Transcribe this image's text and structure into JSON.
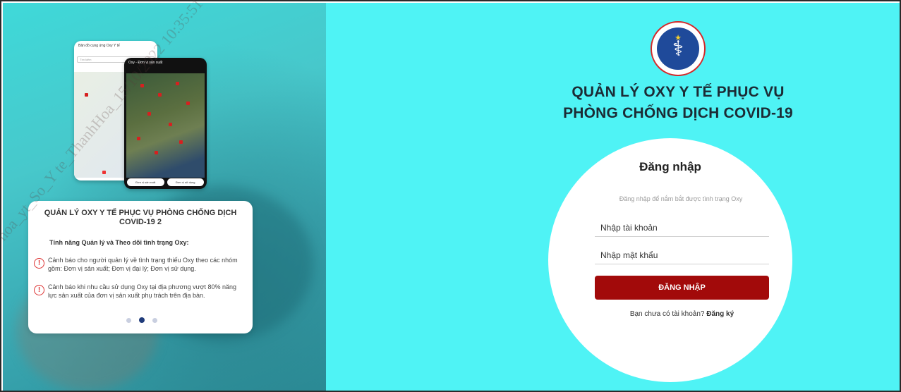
{
  "brand": {
    "logo_text": "BỘ Y TẾ",
    "app_title_line1": "QUẢN LÝ OXY Y TẾ PHỤC VỤ",
    "app_title_line2": "PHÒNG CHỐNG DỊCH COVID-19"
  },
  "login": {
    "heading": "Đăng nhập",
    "subtitle": "Đăng nhập để nắm bắt được tình trạng Oxy",
    "username_placeholder": "Nhập tài khoản",
    "password_placeholder": "Nhập mật khẩu",
    "submit_label": "ĐĂNG NHẬP",
    "register_prompt": "Bạn chưa có tài khoản?",
    "register_link": "Đăng ký"
  },
  "promo_card": {
    "title": "QUẢN LÝ OXY Y TẾ PHỤC VỤ PHÒNG CHỐNG DỊCH COVID-19 2",
    "subtitle": "Tính năng Quản lý và Theo dõi tình trạng Oxy:",
    "features": [
      "Cảnh báo cho người quản lý về tình trạng thiếu Oxy theo các nhóm gồm: Đơn vị sản xuất; Đơn vị đại lý; Đơn vị sử dụng.",
      "Cảnh báo khi nhu cầu sử dụng Oxy tại địa phương vượt 80% năng lực sản xuất của đơn vị sản xuất phụ trách trên địa bàn."
    ],
    "carousel_active_index": 1,
    "carousel_count": 3
  },
  "phone_mock": {
    "screen1_title": "Bản đồ cung ứng Oxy Y tế",
    "screen1_search": "Tìm kiếm",
    "screen2_title": "Oxy - Đơn vị sản xuất",
    "screen2_buttons": [
      "Đơn vị sản xuất",
      "Đơn vị sử dụng"
    ]
  },
  "watermark": "hoa_yt_So_Y te_ThanhHoa_15/10/2022 10:35:51",
  "colors": {
    "right_bg": "#4ff3f5",
    "primary_button": "#a20a0a",
    "title_text": "#1c2b35",
    "warning": "#dd3333"
  }
}
